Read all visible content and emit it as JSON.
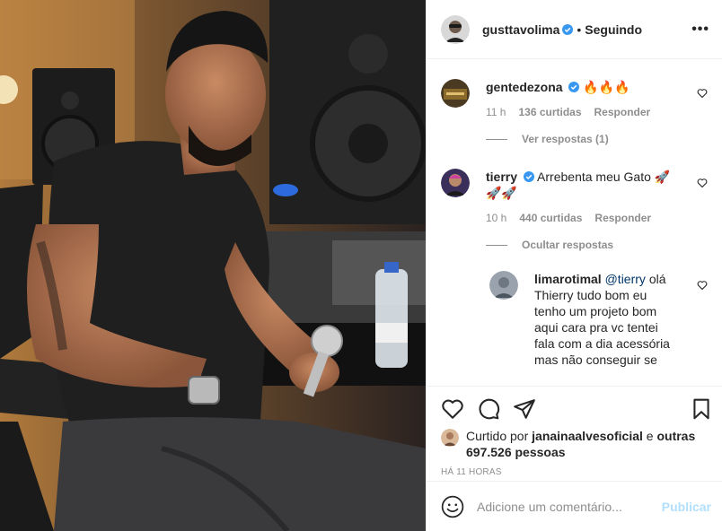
{
  "post": {
    "username": "gusttavolima",
    "separator": "•",
    "follow_status": "Seguindo",
    "more": "•••"
  },
  "comments": [
    {
      "username": "gentedezona",
      "text": "🔥🔥🔥",
      "time": "11 h",
      "likes": "136 curtidas",
      "reply": "Responder",
      "replies_toggle": "Ver respostas (1)"
    },
    {
      "username": "tierry",
      "text": "Arrebenta meu Gato 🚀🚀🚀",
      "time": "10 h",
      "likes": "440 curtidas",
      "reply": "Responder",
      "replies_toggle": "Ocultar respostas",
      "replies": [
        {
          "username": "limarotimal",
          "mention": "@tierry",
          "text": " olá Thierry tudo bom eu tenho um projeto bom aqui cara pra vc tentei fala com a dia acessória mas não conseguir se"
        }
      ]
    }
  ],
  "likes": {
    "prefix": "Curtido por ",
    "liker": "janainaalvesoficial",
    "middle": " e ",
    "others": "outras 697.526 pessoas"
  },
  "timestamp": "HÁ 11 HORAS",
  "add_comment": {
    "placeholder": "Adicione um comentário...",
    "publish": "Publicar"
  },
  "icons": {
    "more": "more-options-icon",
    "like": "heart-icon",
    "comment": "comment-icon",
    "share": "share-icon",
    "save": "bookmark-icon",
    "emoji": "emoji-icon",
    "verified": "verified-badge-icon"
  },
  "colors": {
    "verified": "#3897f0",
    "link": "#00376b",
    "muted": "#8e8e8e",
    "publish_disabled": "#b2dffc"
  }
}
